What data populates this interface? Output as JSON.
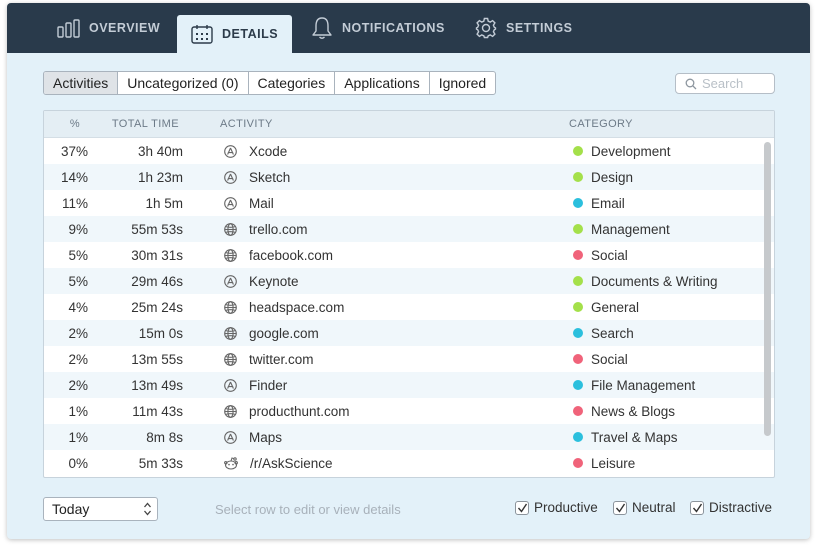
{
  "tabs": [
    {
      "label": "OVERVIEW",
      "icon": "bar-chart-icon",
      "active": false
    },
    {
      "label": "DETAILS",
      "icon": "calendar-icon",
      "active": true
    },
    {
      "label": "NOTIFICATIONS",
      "icon": "bell-icon",
      "active": false
    },
    {
      "label": "SETTINGS",
      "icon": "gear-icon",
      "active": false
    }
  ],
  "filters": {
    "selected": "Activities",
    "items": [
      "Activities",
      "Uncategorized (0)",
      "Categories",
      "Applications",
      "Ignored"
    ]
  },
  "search": {
    "placeholder": "Search",
    "value": ""
  },
  "table": {
    "headers": {
      "pct": "%",
      "time": "TOTAL TIME",
      "activity": "ACTIVITY",
      "category": "CATEGORY"
    },
    "rows": [
      {
        "pct": "37%",
        "time": "3h 40m",
        "icon": "app-store-icon",
        "activity": "Xcode",
        "category": "Development",
        "color": "#a4e04a"
      },
      {
        "pct": "14%",
        "time": "1h 23m",
        "icon": "app-store-icon",
        "activity": "Sketch",
        "category": "Design",
        "color": "#a4e04a"
      },
      {
        "pct": "11%",
        "time": "1h 5m",
        "icon": "app-store-icon",
        "activity": "Mail",
        "category": "Email",
        "color": "#2bbfdd"
      },
      {
        "pct": "9%",
        "time": "55m 53s",
        "icon": "globe-icon",
        "activity": "trello.com",
        "category": "Management",
        "color": "#a4e04a"
      },
      {
        "pct": "5%",
        "time": "30m 31s",
        "icon": "globe-icon",
        "activity": "facebook.com",
        "category": "Social",
        "color": "#f0637a"
      },
      {
        "pct": "5%",
        "time": "29m 46s",
        "icon": "app-store-icon",
        "activity": "Keynote",
        "category": "Documents & Writing",
        "color": "#a4e04a"
      },
      {
        "pct": "4%",
        "time": "25m 24s",
        "icon": "globe-icon",
        "activity": "headspace.com",
        "category": "General",
        "color": "#a4e04a"
      },
      {
        "pct": "2%",
        "time": "15m 0s",
        "icon": "globe-icon",
        "activity": "google.com",
        "category": "Search",
        "color": "#2bbfdd"
      },
      {
        "pct": "2%",
        "time": "13m 55s",
        "icon": "globe-icon",
        "activity": "twitter.com",
        "category": "Social",
        "color": "#f0637a"
      },
      {
        "pct": "2%",
        "time": "13m 49s",
        "icon": "app-store-icon",
        "activity": "Finder",
        "category": "File Management",
        "color": "#2bbfdd"
      },
      {
        "pct": "1%",
        "time": "11m 43s",
        "icon": "globe-icon",
        "activity": "producthunt.com",
        "category": "News & Blogs",
        "color": "#f0637a"
      },
      {
        "pct": "1%",
        "time": "8m 8s",
        "icon": "app-store-icon",
        "activity": "Maps",
        "category": "Travel & Maps",
        "color": "#2bbfdd"
      },
      {
        "pct": "0%",
        "time": "5m 33s",
        "icon": "reddit-icon",
        "activity": "/r/AskScience",
        "category": "Leisure",
        "color": "#f0637a"
      }
    ]
  },
  "footer": {
    "range": "Today",
    "hint": "Select row to edit or view details",
    "checkboxes": [
      {
        "label": "Productive",
        "checked": true
      },
      {
        "label": "Neutral",
        "checked": true
      },
      {
        "label": "Distractive",
        "checked": true
      }
    ]
  }
}
